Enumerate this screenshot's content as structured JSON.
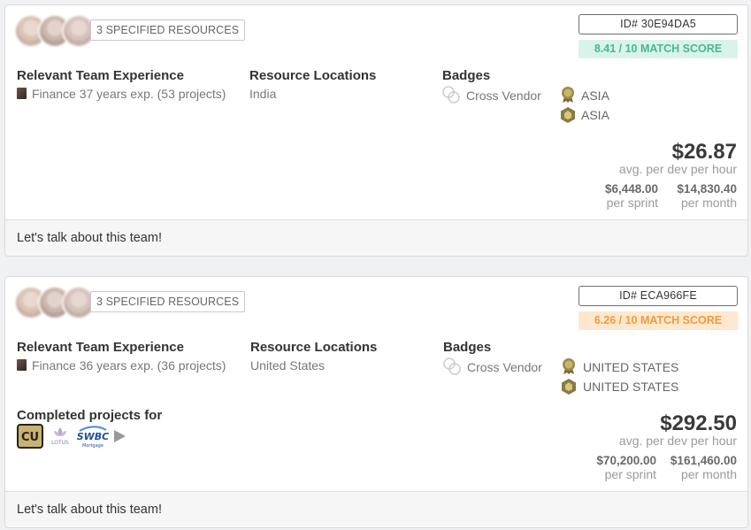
{
  "cards": [
    {
      "resources_label": "3 SPECIFIED RESOURCES",
      "id_label": "ID# 30E94DA5",
      "match_score": "8.41 / 10 MATCH SCORE",
      "score_color": "#47b892",
      "experience_title": "Relevant Team Experience",
      "experience_value": "Finance 37 years exp. (53 projects)",
      "locations_title": "Resource Locations",
      "locations_value": "India",
      "badges_title": "Badges",
      "badge_cross_vendor": "Cross Vendor",
      "badge_region_1": "ASIA",
      "badge_region_2": "ASIA",
      "price": "$26.87",
      "price_caption": "avg. per dev per hour",
      "sprint_value": "$6,448.00",
      "sprint_label": "per sprint",
      "month_value": "$14,830.40",
      "month_label": "per month",
      "footer_text": "Let's talk about this team!"
    },
    {
      "resources_label": "3 SPECIFIED RESOURCES",
      "id_label": "ID# ECA966FE",
      "match_score": "6.26 / 10 MATCH SCORE",
      "score_color": "#f29a3c",
      "experience_title": "Relevant Team Experience",
      "experience_value": "Finance 36 years exp. (36 projects)",
      "locations_title": "Resource Locations",
      "locations_value": "United States",
      "badges_title": "Badges",
      "badge_cross_vendor": "Cross Vendor",
      "badge_region_1": "UNITED STATES",
      "badge_region_2": "UNITED STATES",
      "completed_title": "Completed projects for",
      "logos": {
        "cu": "CU",
        "lotus": "LOTUS",
        "swbc": "SWBC",
        "swbc_sub": "Mortgage"
      },
      "price": "$292.50",
      "price_caption": "avg. per dev per hour",
      "sprint_value": "$70,200.00",
      "sprint_label": "per sprint",
      "month_value": "$161,460.00",
      "month_label": "per month",
      "footer_text": "Let's talk about this team!"
    }
  ]
}
